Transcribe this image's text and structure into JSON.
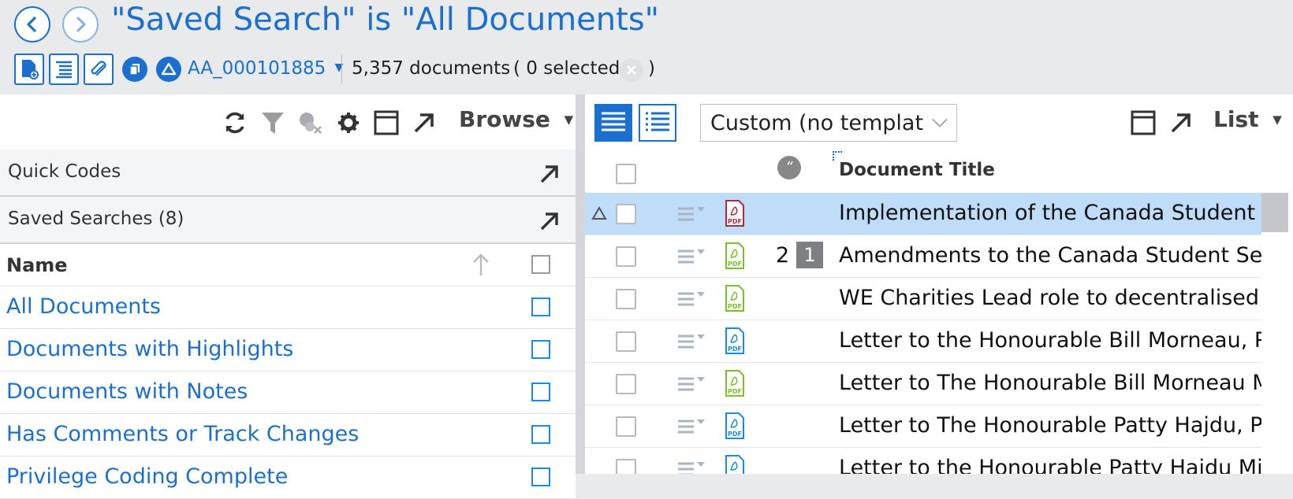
{
  "header": {
    "title": "\"Saved Search\" is \"All Documents\"",
    "back_icon": "chevron-left-icon",
    "forward_icon": "chevron-right-icon",
    "workspace": "AA_000101885",
    "doc_count": "5,357 documents",
    "selected_open": "( 0 selected",
    "selected_close": ")"
  },
  "left": {
    "mode": "Browse",
    "sections": [
      {
        "label": "Quick Codes"
      },
      {
        "label": "Saved Searches (8)"
      }
    ],
    "name_header": "Name",
    "items": [
      {
        "label": "All Documents"
      },
      {
        "label": "Documents with Highlights"
      },
      {
        "label": "Documents with Notes"
      },
      {
        "label": "Has Comments or Track Changes"
      },
      {
        "label": "Privilege Coding Complete"
      }
    ]
  },
  "right": {
    "template": "Custom (no template",
    "mode": "List",
    "column_title": "Document Title",
    "rows": [
      {
        "title": "Implementation of the Canada Student Service Grant",
        "pdf_color": "#b0283a",
        "selected": true
      },
      {
        "title": "Amendments to the Canada Student Service Grant",
        "pdf_color": "#7cbf2a",
        "count": "2",
        "badge": "1"
      },
      {
        "title": "WE Charities Lead role to decentralised National Service",
        "pdf_color": "#7cbf2a"
      },
      {
        "title": "Letter to the Honourable Bill Morneau, P.C.",
        "pdf_color": "#1a8ae8"
      },
      {
        "title": "Letter to The Honourable Bill Morneau Minister",
        "pdf_color": "#7cbf2a"
      },
      {
        "title": "Letter to The Honourable Patty Hajdu, P.C.",
        "pdf_color": "#1a8ae8"
      },
      {
        "title": "Letter to the Honourable Patty Hajdu Minister",
        "pdf_color": "#1a8ae8"
      }
    ]
  },
  "colors": {
    "accent": "#1a6fd0",
    "selected_row": "#bfdcf8"
  }
}
